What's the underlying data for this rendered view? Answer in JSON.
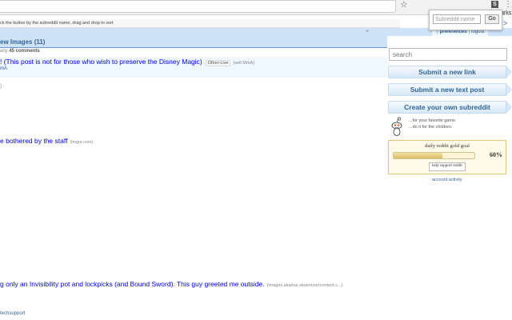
{
  "browser": {
    "star_icon": "star-icon",
    "ext_letter": "S",
    "menu_icon": "more-vert-icon",
    "bookmarks_label": "arks"
  },
  "popup": {
    "placeholder": "Subreddit name",
    "go_label": "Go"
  },
  "hint": "ck the button by the subreddit name, drag and drop to sort",
  "header": {
    "close_char": "×",
    "preferences": "preferences",
    "logout": "logout"
  },
  "tabs": {
    "new_label": "ew Images (11)"
  },
  "posts": [
    {
      "meta_prefix": "any ",
      "comments": "45 comments",
      "title": "! (This post is not for those who wish to preserve the Disney Magic)",
      "flair": "Other-Live",
      "domain": "(self.MmA)",
      "sub": "mA",
      "sub2": ")"
    },
    {
      "title": "e bothered by the staff",
      "domain": "(imgur.com)"
    },
    {
      "title": "g only an Invisibility pot and lockpicks (and Bound Sword). This guy greeted me outside.",
      "domain": "(images.akamai.steamusercontent.c...)",
      "sub": "techsupport"
    }
  ],
  "sidebar": {
    "search_placeholder": "search",
    "submit_link": "Submit a new link",
    "submit_text": "Submit a new text post",
    "create_sub": "Create your own subreddit",
    "tagline1": "...for your favorite game.",
    "tagline2": "...do it for the children.",
    "account_activity": "account activity"
  },
  "gold": {
    "title": "daily reddit gold goal",
    "percent_label": "60%",
    "progress": 0.6,
    "help_label": "help support reddit"
  },
  "colors": {
    "header_bg": "#cee3f8",
    "link": "#0000ff",
    "accent": "#336699",
    "gold_border": "#e6c875"
  }
}
